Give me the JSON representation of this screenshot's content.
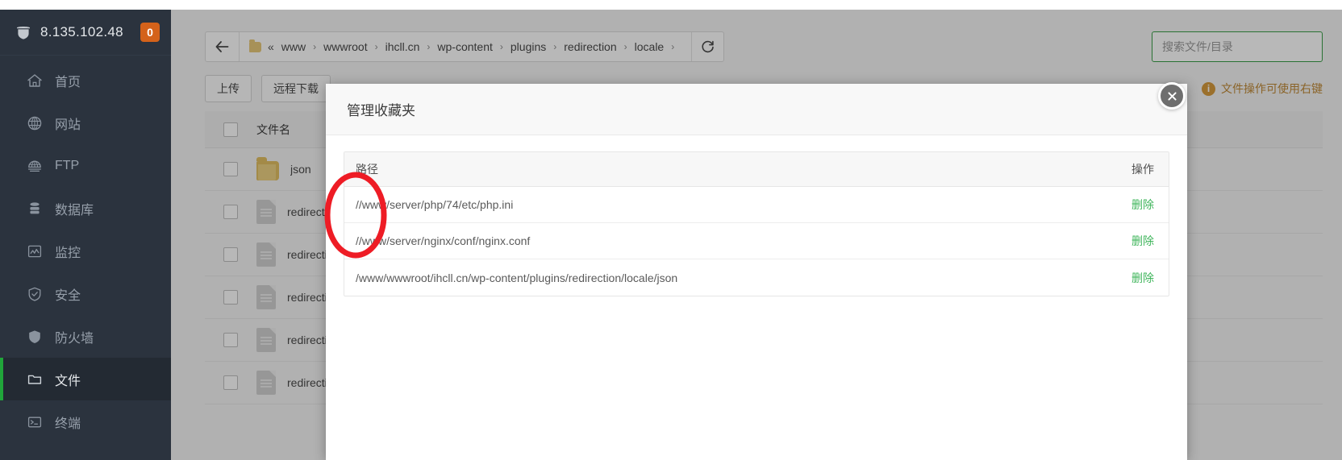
{
  "sidebar": {
    "server_ip": "8.135.102.48",
    "badge": "0",
    "logo_icon": "bt-shield-icon",
    "items": [
      {
        "label": "首页",
        "icon": "home-icon",
        "active": false
      },
      {
        "label": "网站",
        "icon": "globe-icon",
        "active": false
      },
      {
        "label": "FTP",
        "icon": "ftp-icon",
        "active": false
      },
      {
        "label": "数据库",
        "icon": "database-icon",
        "active": false
      },
      {
        "label": "监控",
        "icon": "monitor-icon",
        "active": false
      },
      {
        "label": "安全",
        "icon": "shield-check-icon",
        "active": false
      },
      {
        "label": "防火墙",
        "icon": "shield-icon",
        "active": false
      },
      {
        "label": "文件",
        "icon": "folder-icon",
        "active": true
      },
      {
        "label": "终端",
        "icon": "terminal-icon",
        "active": false
      }
    ]
  },
  "pathbar": {
    "back_icon": "arrow-left-icon",
    "folder_icon": "folder-icon",
    "double_chevron": "«",
    "refresh_icon": "refresh-icon",
    "separator": "›",
    "crumbs": [
      "www",
      "wwwroot",
      "ihcll.cn",
      "wp-content",
      "plugins",
      "redirection",
      "locale"
    ]
  },
  "search": {
    "placeholder": "搜索文件/目录",
    "value": "",
    "border_color": "#3a9f47"
  },
  "toolbar": {
    "buttons": [
      "上传",
      "远程下载"
    ],
    "tip_icon": "info-icon",
    "tip_text": "文件操作可使用右键",
    "tip_color": "#c08a36"
  },
  "file_table": {
    "columns": [
      "文件名"
    ],
    "rows": [
      {
        "icon": "folder-icon",
        "name": "json"
      },
      {
        "icon": "file-icon",
        "name": "redirection"
      },
      {
        "icon": "file-icon",
        "name": "redirection"
      },
      {
        "icon": "file-icon",
        "name": "redirection"
      },
      {
        "icon": "file-icon",
        "name": "redirection"
      },
      {
        "icon": "file-icon",
        "name": "redirection"
      }
    ]
  },
  "modal": {
    "title": "管理收藏夹",
    "close_icon": "close-icon",
    "table": {
      "columns": {
        "path": "路径",
        "action": "操作"
      },
      "rows": [
        {
          "path": "//www/server/php/74/etc/php.ini",
          "action": "删除"
        },
        {
          "path": "//www/server/nginx/conf/nginx.conf",
          "action": "删除"
        },
        {
          "path": "/www/wwwroot/ihcll.cn/wp-content/plugins/redirection/locale/json",
          "action": "删除"
        }
      ]
    },
    "action_color": "#3fb55b"
  },
  "annotation": {
    "shape": "ellipse",
    "color": "#ee1c25"
  }
}
